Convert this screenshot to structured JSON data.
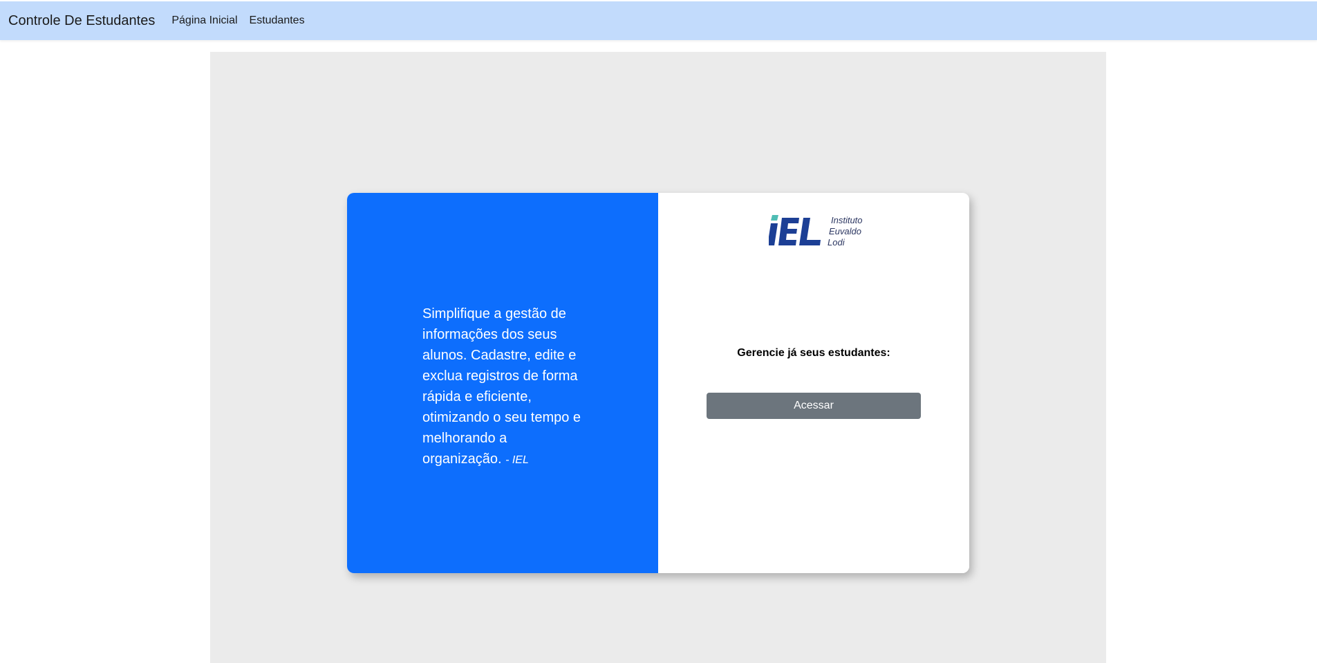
{
  "navbar": {
    "brand": "Controle De Estudantes",
    "links": [
      "Página Inicial",
      "Estudantes"
    ],
    "background": "#c2dbfc"
  },
  "hero": {
    "quote": "Simplifique a gestão de informações dos seus alunos. Cadastre, edite e exclua registros de forma rápida e eficiente, otimizando o seu tempo e melhorando a organização.",
    "quote_author": "- IEL",
    "panel_color": "#0d6efd"
  },
  "login": {
    "logo": {
      "mark": "iEL",
      "lines": [
        "Instituto",
        "Euvaldo",
        "Lodi"
      ]
    },
    "headline": "Gerencie já seus estudantes:",
    "button_label": "Acessar",
    "button_color": "#6c757d"
  }
}
